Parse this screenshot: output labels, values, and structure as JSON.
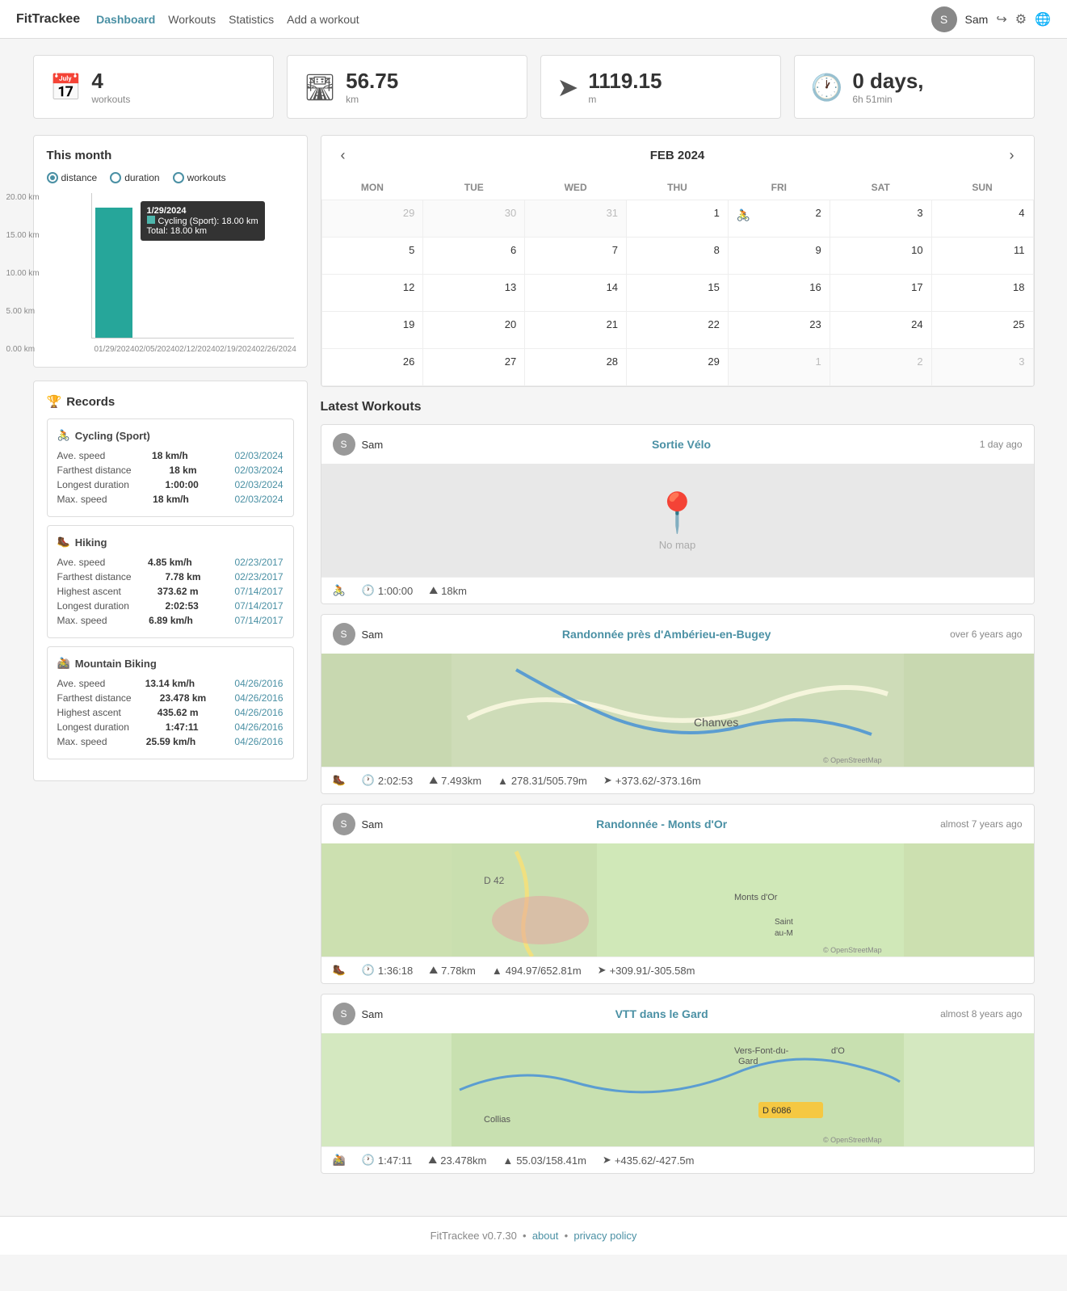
{
  "brand": "FitTrackee",
  "nav": {
    "links": [
      {
        "label": "Dashboard",
        "active": true,
        "id": "dashboard"
      },
      {
        "label": "Workouts",
        "active": false,
        "id": "workouts"
      },
      {
        "label": "Statistics",
        "active": false,
        "id": "statistics"
      },
      {
        "label": "Add a workout",
        "active": false,
        "id": "add-workout"
      }
    ],
    "username": "Sam",
    "icons": {
      "logout": "↪",
      "settings": "⚙",
      "language": "🌐"
    }
  },
  "stat_cards": [
    {
      "icon": "📅",
      "number": "4",
      "label": "workouts"
    },
    {
      "icon": "🛣",
      "number": "56.75",
      "label": "km"
    },
    {
      "icon": "➤",
      "number": "1119.15",
      "label": "m"
    },
    {
      "icon": "🕐",
      "number": "0 days,",
      "label": "6h 51min"
    }
  ],
  "this_month": {
    "title": "This month",
    "radio_options": [
      "distance",
      "duration",
      "workouts"
    ],
    "selected": "distance",
    "chart": {
      "y_labels": [
        "20.00 km",
        "15.00 km",
        "10.00 km",
        "5.00 km",
        "0.00 km"
      ],
      "bars": [
        {
          "date": "01/29/2024",
          "value": 100,
          "highlighted": true
        },
        {
          "date": "02/05/2024",
          "value": 0
        },
        {
          "date": "02/12/2024",
          "value": 0
        },
        {
          "date": "02/19/2024",
          "value": 0
        },
        {
          "date": "02/26/2024",
          "value": 0
        }
      ],
      "x_labels": [
        "01/29/2024",
        "02/05/2024",
        "02/12/2024",
        "02/19/2024",
        "02/26/2024"
      ],
      "tooltip": {
        "date": "1/29/2024",
        "sport": "Cycling (Sport)",
        "value": "18.00 km",
        "total": "Total: 18.00 km"
      }
    }
  },
  "records": {
    "title": "Records",
    "sports": [
      {
        "name": "Cycling (Sport)",
        "icon": "🚴",
        "rows": [
          {
            "label": "Ave. speed",
            "value": "18 km/h",
            "date": "02/03/2024"
          },
          {
            "label": "Farthest distance",
            "value": "18 km",
            "date": "02/03/2024"
          },
          {
            "label": "Longest duration",
            "value": "1:00:00",
            "date": "02/03/2024"
          },
          {
            "label": "Max. speed",
            "value": "18 km/h",
            "date": "02/03/2024"
          }
        ]
      },
      {
        "name": "Hiking",
        "icon": "🥾",
        "rows": [
          {
            "label": "Ave. speed",
            "value": "4.85 km/h",
            "date": "02/23/2017"
          },
          {
            "label": "Farthest distance",
            "value": "7.78 km",
            "date": "02/23/2017"
          },
          {
            "label": "Highest ascent",
            "value": "373.62 m",
            "date": "07/14/2017"
          },
          {
            "label": "Longest duration",
            "value": "2:02:53",
            "date": "07/14/2017"
          },
          {
            "label": "Max. speed",
            "value": "6.89 km/h",
            "date": "07/14/2017"
          }
        ]
      },
      {
        "name": "Mountain Biking",
        "icon": "🚵",
        "rows": [
          {
            "label": "Ave. speed",
            "value": "13.14 km/h",
            "date": "04/26/2016"
          },
          {
            "label": "Farthest distance",
            "value": "23.478 km",
            "date": "04/26/2016"
          },
          {
            "label": "Highest ascent",
            "value": "435.62 m",
            "date": "04/26/2016"
          },
          {
            "label": "Longest duration",
            "value": "1:47:11",
            "date": "04/26/2016"
          },
          {
            "label": "Max. speed",
            "value": "25.59 km/h",
            "date": "04/26/2016"
          }
        ]
      }
    ]
  },
  "calendar": {
    "title": "FEB 2024",
    "days": [
      "MON",
      "TUE",
      "WED",
      "THU",
      "FRI",
      "SAT",
      "SUN"
    ],
    "weeks": [
      [
        {
          "day": "29",
          "other": true
        },
        {
          "day": "30",
          "other": true
        },
        {
          "day": "31",
          "other": true
        },
        {
          "day": "1"
        },
        {
          "day": "2",
          "workout": "🚴"
        },
        {
          "day": "3"
        },
        {
          "day": "4",
          "other": false
        }
      ],
      [
        {
          "day": "5"
        },
        {
          "day": "6"
        },
        {
          "day": "7"
        },
        {
          "day": "8"
        },
        {
          "day": "9"
        },
        {
          "day": "10"
        },
        {
          "day": "11"
        }
      ],
      [
        {
          "day": "12"
        },
        {
          "day": "13"
        },
        {
          "day": "14"
        },
        {
          "day": "15"
        },
        {
          "day": "16"
        },
        {
          "day": "17"
        },
        {
          "day": "18"
        }
      ],
      [
        {
          "day": "19"
        },
        {
          "day": "20"
        },
        {
          "day": "21"
        },
        {
          "day": "22"
        },
        {
          "day": "23"
        },
        {
          "day": "24"
        },
        {
          "day": "25"
        }
      ],
      [
        {
          "day": "26"
        },
        {
          "day": "27"
        },
        {
          "day": "28"
        },
        {
          "day": "29"
        },
        {
          "day": "1",
          "other": true
        },
        {
          "day": "2",
          "other": true
        },
        {
          "day": "3",
          "other": true
        }
      ]
    ]
  },
  "latest_workouts": {
    "title": "Latest Workouts",
    "workouts": [
      {
        "user": "Sam",
        "title": "Sortie Vélo",
        "time_ago": "1 day ago",
        "has_map": false,
        "sport_icon": "🚴",
        "duration": "1:00:00",
        "distance": "18km",
        "elevation": null,
        "speed": null,
        "map_type": "nomap"
      },
      {
        "user": "Sam",
        "title": "Randonnée près d'Ambérieu-en-Bugey",
        "time_ago": "over 6 years ago",
        "has_map": true,
        "sport_icon": "🥾",
        "duration": "2:02:53",
        "distance": "7.493km",
        "elevation": "278.31/505.79m",
        "speed": "+373.62/-373.16m",
        "map_type": "hiking"
      },
      {
        "user": "Sam",
        "title": "Randonnée - Monts d'Or",
        "time_ago": "almost 7 years ago",
        "has_map": true,
        "sport_icon": "🥾",
        "duration": "1:36:18",
        "distance": "7.78km",
        "elevation": "494.97/652.81m",
        "speed": "+309.91/-305.58m",
        "map_type": "hiking2"
      },
      {
        "user": "Sam",
        "title": "VTT dans le Gard",
        "time_ago": "almost 8 years ago",
        "has_map": true,
        "sport_icon": "🚵",
        "duration": "1:47:11",
        "distance": "23.478km",
        "elevation": "55.03/158.41m",
        "speed": "+435.62/-427.5m",
        "map_type": "mtb"
      }
    ]
  },
  "footer": {
    "brand": "FitTrackee",
    "version": "v0.7.30",
    "links": [
      {
        "label": "about",
        "href": "#"
      },
      {
        "label": "privacy policy",
        "href": "#"
      }
    ]
  }
}
